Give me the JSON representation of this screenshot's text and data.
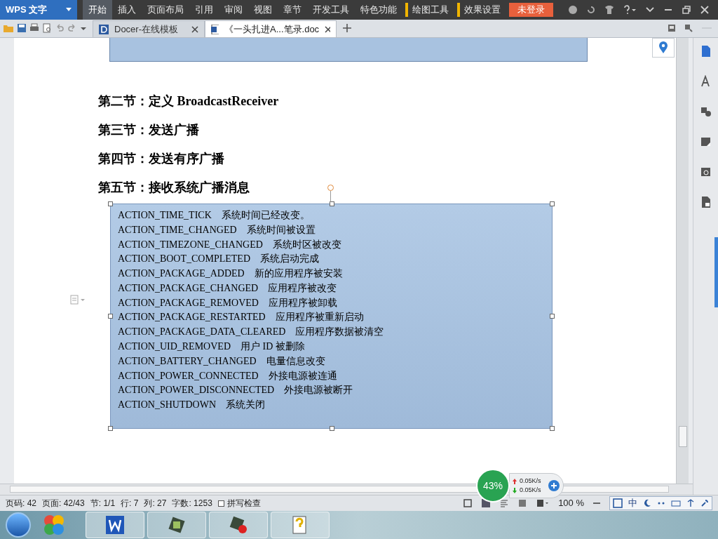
{
  "app_menu": {
    "label": "WPS 文字"
  },
  "ribbon_tabs": [
    {
      "label": "开始",
      "selected": true
    },
    {
      "label": "插入",
      "selected": false
    },
    {
      "label": "页面布局",
      "selected": false
    },
    {
      "label": "引用",
      "selected": false
    },
    {
      "label": "审阅",
      "selected": false
    },
    {
      "label": "视图",
      "selected": false
    },
    {
      "label": "章节",
      "selected": false
    },
    {
      "label": "开发工具",
      "selected": false
    },
    {
      "label": "特色功能",
      "selected": false
    }
  ],
  "context_tabs": [
    {
      "label": "绘图工具"
    },
    {
      "label": "效果设置"
    }
  ],
  "login_button": {
    "label": "未登录"
  },
  "doc_tabs": [
    {
      "kind": "docer",
      "label": "Docer-在线模板",
      "selected": false
    },
    {
      "kind": "doc",
      "label": "《一头扎进A...笔录.doc",
      "selected": true
    }
  ],
  "document": {
    "headings": [
      "第二节：定义 BroadcastReceiver",
      "第三节：发送广播",
      "第四节：发送有序广播",
      "第五节：接收系统广播消息"
    ],
    "text_box": [
      {
        "constant": "ACTION_TIME_TICK",
        "description": "系统时间已经改变。"
      },
      {
        "constant": "ACTION_TIME_CHANGED",
        "description": "系统时间被设置"
      },
      {
        "constant": "ACTION_TIMEZONE_CHANGED",
        "description": "系统时区被改变"
      },
      {
        "constant": "ACTION_BOOT_COMPLETED",
        "description": "系统启动完成"
      },
      {
        "constant": "ACTION_PACKAGE_ADDED",
        "description": "新的应用程序被安装"
      },
      {
        "constant": "ACTION_PACKAGE_CHANGED",
        "description": "应用程序被改变"
      },
      {
        "constant": "ACTION_PACKAGE_REMOVED",
        "description": "应用程序被卸载"
      },
      {
        "constant": "ACTION_PACKAGE_RESTARTED",
        "description": "应用程序被重新启动"
      },
      {
        "constant": "ACTION_PACKAGE_DATA_CLEARED",
        "description": "应用程序数据被清空"
      },
      {
        "constant": "ACTION_UID_REMOVED",
        "description": "用户 ID 被删除"
      },
      {
        "constant": "ACTION_BATTERY_CHANGED",
        "description": "电量信息改变"
      },
      {
        "constant": "ACTION_POWER_CONNECTED",
        "description": "外接电源被连通"
      },
      {
        "constant": "ACTION_POWER_DISCONNECTED",
        "description": "外接电源被断开"
      },
      {
        "constant": "ACTION_SHUTDOWN",
        "description": "系统关闭"
      }
    ]
  },
  "net_widget": {
    "percent": "43%",
    "upload": "0.05K/s",
    "download": "0.05K/s"
  },
  "status_bar": {
    "items": [
      "页码: 42",
      "页面: 42/43",
      "节: 1/1",
      "行: 7",
      "列: 27",
      "字数: 1253"
    ],
    "spell_check": {
      "label": "拼写检查",
      "checked": false
    },
    "zoom": "100 %"
  },
  "ime_bar": {
    "label": "中"
  }
}
